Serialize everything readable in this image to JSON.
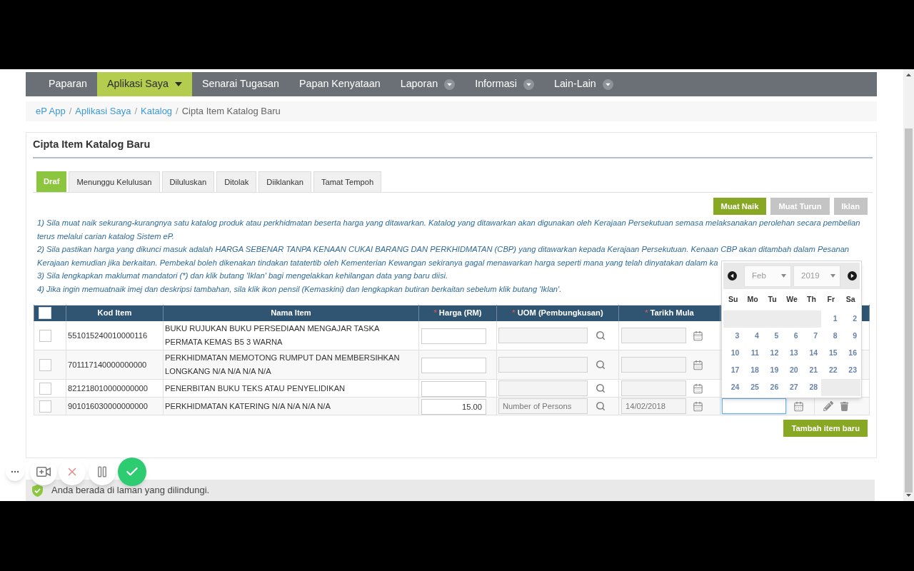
{
  "nav": {
    "items": [
      {
        "label": "Paparan",
        "selected": false,
        "dropdown": false
      },
      {
        "label": "Aplikasi Saya",
        "selected": true,
        "dropdown": true
      },
      {
        "label": "Senarai Tugasan",
        "selected": false,
        "dropdown": false
      },
      {
        "label": "Papan Kenyataan",
        "selected": false,
        "dropdown": false
      },
      {
        "label": "Laporan",
        "selected": false,
        "dropdown": true
      },
      {
        "label": "Informasi",
        "selected": false,
        "dropdown": true
      },
      {
        "label": "Lain-Lain",
        "selected": false,
        "dropdown": true
      }
    ]
  },
  "breadcrumb": [
    {
      "label": "eP App",
      "kind": "link"
    },
    {
      "separator": "/",
      "label": "Aplikasi Saya",
      "kind": "link"
    },
    {
      "separator": "/",
      "label": "Katalog",
      "kind": "link"
    },
    {
      "separator": "/",
      "label": "Cipta Item Katalog Baru",
      "kind": "current"
    }
  ],
  "panel": {
    "title": "Cipta Item Katalog Baru",
    "tabs": [
      {
        "label": "Draf",
        "selected": true
      },
      {
        "label": "Menunggu Kelulusan",
        "selected": false
      },
      {
        "label": "Diluluskan",
        "selected": false
      },
      {
        "label": "Ditolak",
        "selected": false
      },
      {
        "label": "Diiklankan",
        "selected": false
      },
      {
        "label": "Tamat Tempoh",
        "selected": false
      }
    ],
    "toolbar": [
      {
        "label": "Muat Naik",
        "disabled": false
      },
      {
        "label": "Muat Turun",
        "disabled": true
      },
      {
        "label": "Iklan",
        "disabled": true
      }
    ],
    "instructions": [
      {
        "lines": [
          "1) Sila muat naik sekurang-kurangnya satu katalog produk atau perkhidmatan beserta harga yang ditawarkan. Katalog yang ditawarkan akan digunakan oleh Kerajaan Persekutuan semasa melaksanakan perolehan secara pembelian",
          "terus melalui carian katalog Sistem eP."
        ]
      },
      {
        "lines": [
          "2) Sila pastikan harga yang dikunci masuk adalah HARGA SEBENAR TANPA KENAAN CUKAI BARANG DAN PERKHIDMATAN (CBP) yang ditawarkan kepada Kerajaan Persekutuan. Kenaan CBP akan ditambah dalam Pesanan",
          "Kerajaan kemudian jika berkaitan. Pembekal boleh dikenakan tindakan tatatertib oleh Kementerian Kewangan sekiranya gagal menawarkan harga seperti mana yang telah dinyatakan dalam ka"
        ]
      },
      {
        "lines": [
          "3) Sila lengkapkan maklumat mandatori (*) dan klik butang 'Iklan' bagi mengelakkan kehilangan data yang baru diisi."
        ]
      },
      {
        "lines": [
          "4) Jika ingin memuatnaik imej dan deskripsi tambahan, sila klik ikon pensil (Kemaskini) dan lengkapkan butiran berkaitan sebelum klik butang 'Iklan'."
        ]
      }
    ],
    "table": {
      "header_checkbox": {
        "checked": false
      },
      "columns": [
        {
          "kind": "select"
        },
        {
          "kind": "text",
          "label": "Kod Item"
        },
        {
          "kind": "text",
          "label": "Nama Item"
        },
        {
          "kind": "text",
          "label": "Harga (RM)",
          "required_mark": "*"
        },
        {
          "kind": "text",
          "label": "UOM (Pembungkusan)",
          "required_mark": "*"
        },
        {
          "kind": "text",
          "label": "Tarikh Mula",
          "required_mark": "*"
        },
        {
          "kind": "hidden"
        },
        {
          "kind": "hidden"
        }
      ],
      "rows": [
        {
          "checked": false,
          "code": "551015240010000116",
          "name": "BUKU RUJUKAN BUKU PERSEDIAAN MENGAJAR TASKA PERMATA KEMAS B5 3 WARNA"
        },
        {
          "checked": false,
          "code": "701117140000000000",
          "name": "PERKHIDMATAN MEMOTONG RUMPUT DAN MEMBERSIHKAN LONGKANG N/A N/A N/A N/A"
        },
        {
          "checked": false,
          "code": "821218010000000000",
          "name": "PENERBITAN BUKU TEKS ATAU PENYELIDIKAN"
        },
        {
          "checked": false,
          "code": "901016030000000000",
          "name": "PERKHIDMATAN KATERING N/A N/A N/A N/A",
          "price": "15.00",
          "uom": "Number of Persons",
          "start_date": "14/02/2018",
          "end_date": {
            "focused": true
          },
          "actions": true
        }
      ]
    },
    "add_button": {
      "label": "Tambah item baru"
    },
    "datepicker": {
      "month": "Feb",
      "year": "2019",
      "weekdays": [
        "Su",
        "Mo",
        "Tu",
        "We",
        "Th",
        "Fr",
        "Sa"
      ],
      "weeks": [
        [
          {
            "kind": "blank"
          },
          {
            "kind": "blank"
          },
          {
            "kind": "blank"
          },
          {
            "kind": "blank"
          },
          {
            "kind": "blank"
          },
          {
            "kind": "day",
            "label": "1"
          },
          {
            "kind": "day",
            "label": "2"
          }
        ],
        [
          {
            "kind": "day",
            "label": "3"
          },
          {
            "kind": "day",
            "label": "4"
          },
          {
            "kind": "day",
            "label": "5"
          },
          {
            "kind": "day",
            "label": "6"
          },
          {
            "kind": "day",
            "label": "7"
          },
          {
            "kind": "day",
            "label": "8"
          },
          {
            "kind": "day",
            "label": "9"
          }
        ],
        [
          {
            "kind": "day",
            "label": "10"
          },
          {
            "kind": "day",
            "label": "11"
          },
          {
            "kind": "day",
            "label": "12"
          },
          {
            "kind": "day",
            "label": "13"
          },
          {
            "kind": "day",
            "label": "14"
          },
          {
            "kind": "day",
            "label": "15"
          },
          {
            "kind": "day",
            "label": "16"
          }
        ],
        [
          {
            "kind": "day",
            "label": "17"
          },
          {
            "kind": "day",
            "label": "18"
          },
          {
            "kind": "day",
            "label": "19"
          },
          {
            "kind": "day",
            "label": "20"
          },
          {
            "kind": "day",
            "label": "21"
          },
          {
            "kind": "day",
            "label": "22"
          },
          {
            "kind": "day",
            "label": "23"
          }
        ],
        [
          {
            "kind": "day",
            "label": "24"
          },
          {
            "kind": "day",
            "label": "25"
          },
          {
            "kind": "day",
            "label": "26"
          },
          {
            "kind": "day",
            "label": "27"
          },
          {
            "kind": "day",
            "label": "28"
          },
          {
            "kind": "blank"
          },
          {
            "kind": "blank"
          }
        ]
      ]
    }
  },
  "footer": {
    "text": "Anda berada di laman yang dilindungi."
  }
}
